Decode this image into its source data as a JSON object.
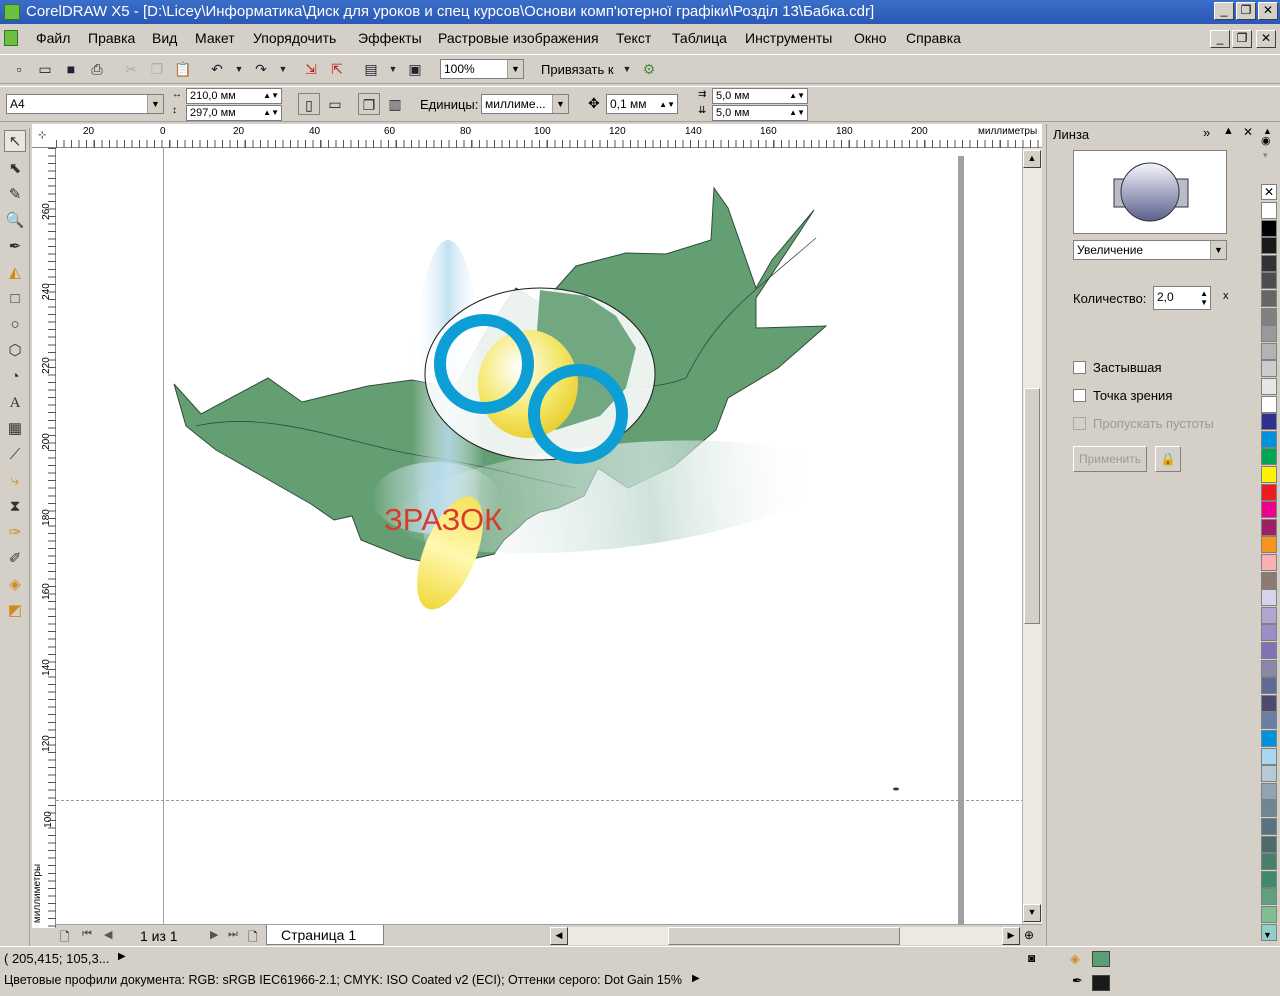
{
  "window": {
    "title": "CorelDRAW X5 - [D:\\Licey\\Информатика\\Диск для уроков и спец курсов\\Основи комп'ютерної графіки\\Розділ 13\\Бабка.cdr]"
  },
  "menu": [
    "Файл",
    "Правка",
    "Вид",
    "Макет",
    "Упорядочить",
    "Эффекты",
    "Растровые изображения",
    "Текст",
    "Таблица",
    "Инструменты",
    "Окно",
    "Справка"
  ],
  "standard_toolbar": {
    "zoom": "100%",
    "snap_label": "Привязать к"
  },
  "property_bar": {
    "page_size": "A4",
    "width": "210,0 мм",
    "height": "297,0 мм",
    "units_label": "Единицы:",
    "units_value": "миллиме...",
    "nudge": "0,1 мм",
    "dup_x": "5,0 мм",
    "dup_y": "5,0 мм"
  },
  "rulers": {
    "h_ticks": [
      "20",
      "0",
      "20",
      "40",
      "60",
      "80",
      "100",
      "120",
      "140",
      "160",
      "180",
      "200"
    ],
    "h_unit": "миллиметры",
    "v_ticks": [
      "260",
      "240",
      "220",
      "200",
      "180",
      "160",
      "140",
      "120",
      "100"
    ],
    "v_unit": "миллиметры"
  },
  "canvas": {
    "artwork_text": "ЗРАЗОК"
  },
  "page_nav": {
    "counter": "1 из 1",
    "page_tab": "Страница 1"
  },
  "docker": {
    "title": "Линза",
    "lens_type": "Увеличение",
    "amount_label": "Количество:",
    "amount_value": "2,0",
    "amount_unit": "x",
    "frozen": "Застывшая",
    "viewpoint": "Точка зрения",
    "skip_blanks": "Пропускать пустоты",
    "apply": "Применить"
  },
  "palette": [
    "#ffffff",
    "#000000",
    "#1a1a1a",
    "#333333",
    "#4d4d4d",
    "#666666",
    "#808080",
    "#999999",
    "#b3b3b3",
    "#cccccc",
    "#e6e6e6",
    "#ffffff",
    "#2e3192",
    "#0093dd",
    "#00a651",
    "#fff200",
    "#ed1c24",
    "#ec008c",
    "#9e1f63",
    "#f7941d",
    "#f9b0b3",
    "#8c7b70",
    "#d7d3ea",
    "#b2a5d4",
    "#9b8dc8",
    "#7f73b5",
    "#8b87a8",
    "#5d6b95",
    "#4b4b6e",
    "#6a7fa4",
    "#0093dd",
    "#a8d8f0",
    "#b7c9d6",
    "#8fa3b0",
    "#6f8795",
    "#5a7380",
    "#4d6b6b",
    "#4a7f6d",
    "#3d8a6e",
    "#5fa07f",
    "#7fbf8f",
    "#8ed0c8"
  ],
  "status": {
    "coords": "( 205,415; 105,3...",
    "color_profiles": "Цветовые профили документа: RGB: sRGB IEC61966-2.1; CMYK: ISO Coated v2 (ECI); Оттенки серого: Dot Gain 15%",
    "fill_color": "#5c9e74",
    "outline_color": "#1a1a1a"
  }
}
